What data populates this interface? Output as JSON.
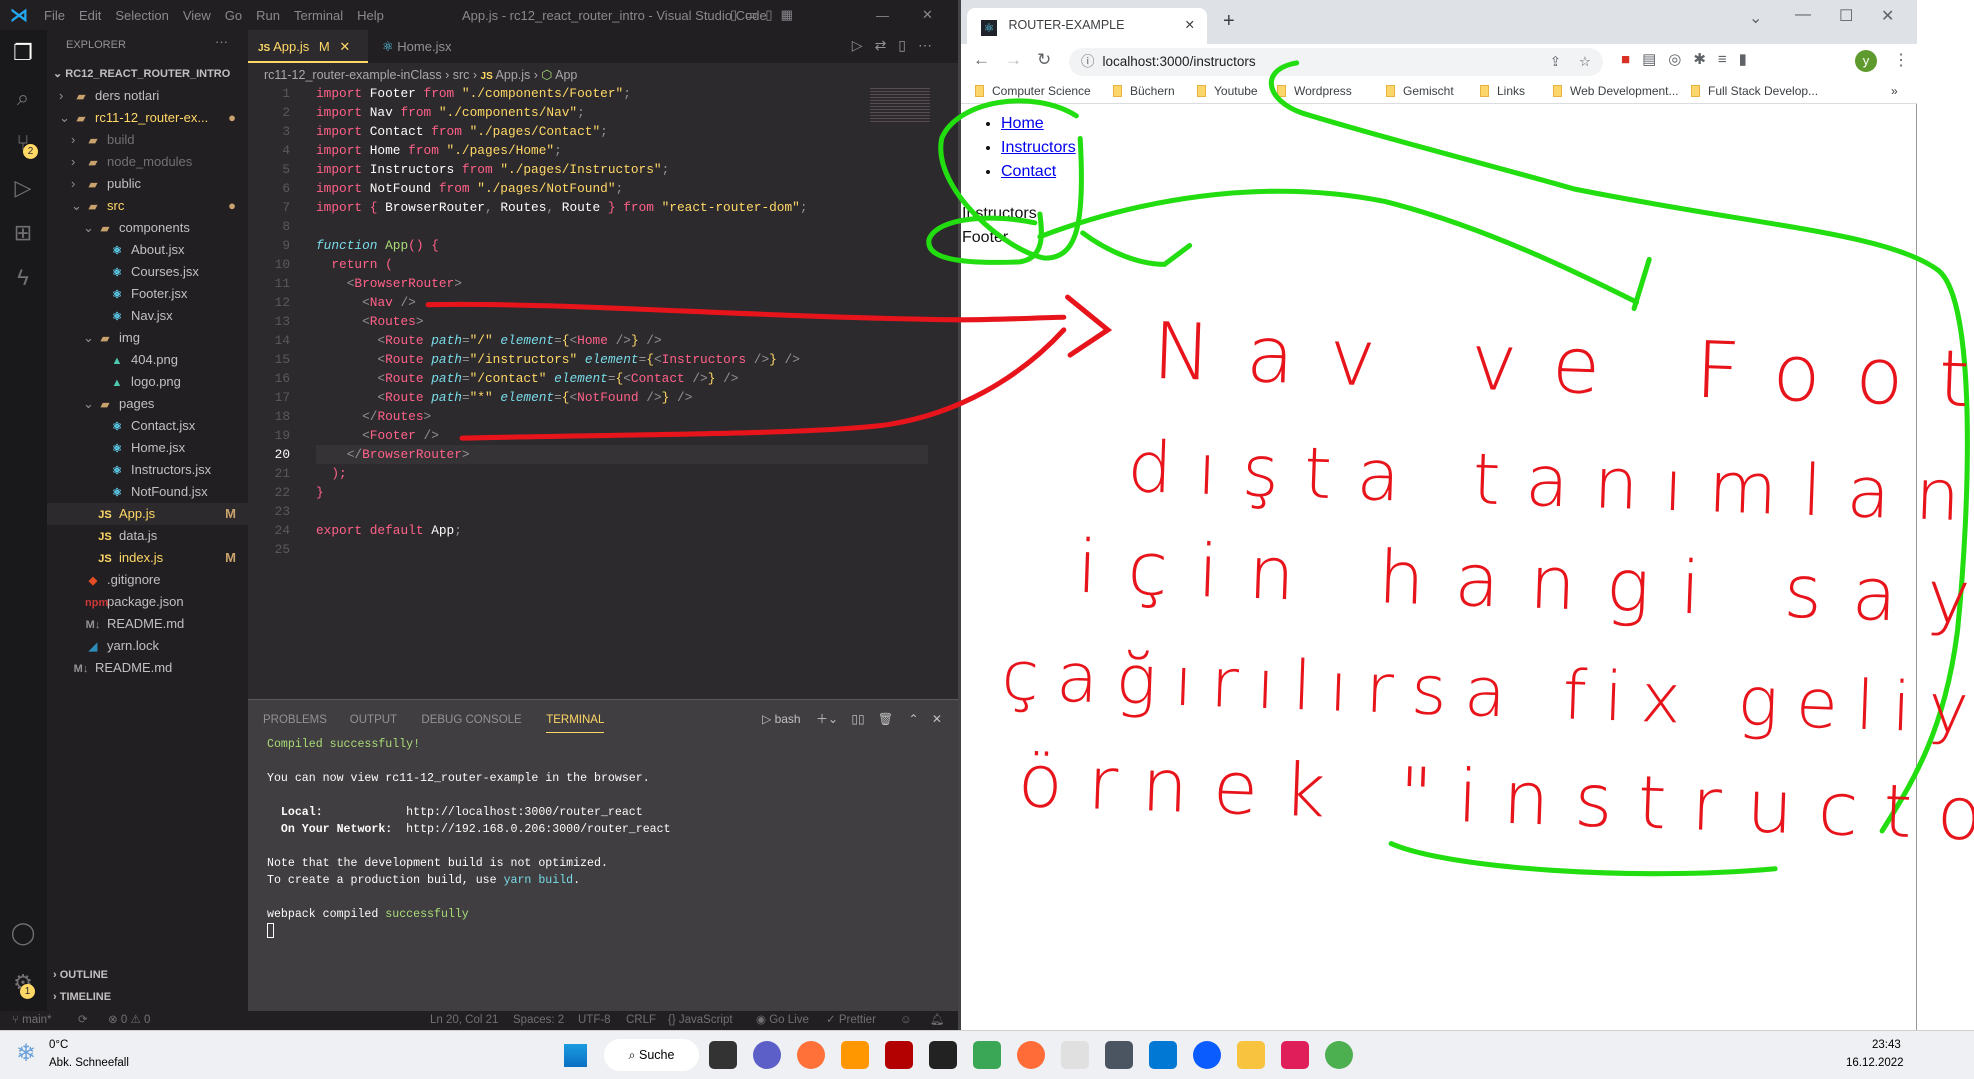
{
  "vscode": {
    "menu": [
      "File",
      "Edit",
      "Selection",
      "View",
      "Go",
      "Run",
      "Terminal",
      "Help"
    ],
    "window_title": "App.js - rc12_react_router_intro - Visual Studio Code",
    "activity_badges": {
      "scm": "2",
      "settings": "1"
    },
    "explorer": {
      "title": "EXPLORER",
      "root": "RC12_REACT_ROUTER_INTRO",
      "items": [
        {
          "label": "ders notlari",
          "depth": 1,
          "icon": "folder",
          "chev": "closed"
        },
        {
          "label": "rc11-12_router-ex...",
          "depth": 1,
          "icon": "folder-open",
          "chev": "open",
          "status": "●",
          "color": "#ffd866"
        },
        {
          "label": "build",
          "depth": 2,
          "icon": "folder",
          "chev": "closed",
          "color": "#727072"
        },
        {
          "label": "node_modules",
          "depth": 2,
          "icon": "folder",
          "chev": "closed",
          "color": "#727072"
        },
        {
          "label": "public",
          "depth": 2,
          "icon": "folder",
          "chev": "closed"
        },
        {
          "label": "src",
          "depth": 2,
          "icon": "folder-open",
          "chev": "open",
          "status": "●",
          "color": "#ffd866"
        },
        {
          "label": "components",
          "depth": 3,
          "icon": "folder-open",
          "chev": "open"
        },
        {
          "label": "About.jsx",
          "depth": 4,
          "icon": "react"
        },
        {
          "label": "Courses.jsx",
          "depth": 4,
          "icon": "react"
        },
        {
          "label": "Footer.jsx",
          "depth": 4,
          "icon": "react"
        },
        {
          "label": "Nav.jsx",
          "depth": 4,
          "icon": "react"
        },
        {
          "label": "img",
          "depth": 3,
          "icon": "folder-open",
          "chev": "open"
        },
        {
          "label": "404.png",
          "depth": 4,
          "icon": "image"
        },
        {
          "label": "logo.png",
          "depth": 4,
          "icon": "image"
        },
        {
          "label": "pages",
          "depth": 3,
          "icon": "folder-open",
          "chev": "open"
        },
        {
          "label": "Contact.jsx",
          "depth": 4,
          "icon": "react"
        },
        {
          "label": "Home.jsx",
          "depth": 4,
          "icon": "react"
        },
        {
          "label": "Instructors.jsx",
          "depth": 4,
          "icon": "react"
        },
        {
          "label": "NotFound.jsx",
          "depth": 4,
          "icon": "react"
        },
        {
          "label": "App.js",
          "depth": 3,
          "icon": "js",
          "status": "M",
          "color": "#ffd866",
          "active": true
        },
        {
          "label": "data.js",
          "depth": 3,
          "icon": "js"
        },
        {
          "label": "index.js",
          "depth": 3,
          "icon": "js",
          "status": "M",
          "color": "#ffd866"
        },
        {
          "label": ".gitignore",
          "depth": 2,
          "icon": "git"
        },
        {
          "label": "package.json",
          "depth": 2,
          "icon": "npm"
        },
        {
          "label": "README.md",
          "depth": 2,
          "icon": "md"
        },
        {
          "label": "yarn.lock",
          "depth": 2,
          "icon": "yarn"
        },
        {
          "label": "README.md",
          "depth": 1,
          "icon": "md"
        }
      ],
      "outline": "OUTLINE",
      "timeline": "TIMELINE"
    },
    "tabs": [
      {
        "label": "App.js",
        "icon": "JS",
        "modified": "M",
        "active": true
      },
      {
        "label": "Home.jsx",
        "icon": "react"
      }
    ],
    "breadcrumb": [
      "rc11-12_router-example-inClass",
      "src",
      "App.js",
      "App"
    ],
    "code": [
      [
        [
          "import",
          "k"
        ],
        [
          " Footer ",
          "t"
        ],
        [
          "from",
          "k"
        ],
        [
          " \"./components/Footer\"",
          "s"
        ],
        [
          ";",
          "p"
        ]
      ],
      [
        [
          "import",
          "k"
        ],
        [
          " Nav ",
          "t"
        ],
        [
          "from",
          "k"
        ],
        [
          " \"./components/Nav\"",
          "s"
        ],
        [
          ";",
          "p"
        ]
      ],
      [
        [
          "import",
          "k"
        ],
        [
          " Contact ",
          "t"
        ],
        [
          "from",
          "k"
        ],
        [
          " \"./pages/Contact\"",
          "s"
        ],
        [
          ";",
          "p"
        ]
      ],
      [
        [
          "import",
          "k"
        ],
        [
          " Home ",
          "t"
        ],
        [
          "from",
          "k"
        ],
        [
          " \"./pages/Home\"",
          "s"
        ],
        [
          ";",
          "p"
        ]
      ],
      [
        [
          "import",
          "k"
        ],
        [
          " Instructors ",
          "t"
        ],
        [
          "from",
          "k"
        ],
        [
          " \"./pages/Instructors\"",
          "s"
        ],
        [
          ";",
          "p"
        ]
      ],
      [
        [
          "import",
          "k"
        ],
        [
          " NotFound ",
          "t"
        ],
        [
          "from",
          "k"
        ],
        [
          " \"./pages/NotFound\"",
          "s"
        ],
        [
          ";",
          "p"
        ]
      ],
      [
        [
          "import",
          "k"
        ],
        [
          " { ",
          "k"
        ],
        [
          "BrowserRouter",
          "t"
        ],
        [
          ", ",
          "p"
        ],
        [
          "Routes",
          "t"
        ],
        [
          ", ",
          "p"
        ],
        [
          "Route",
          "t"
        ],
        [
          " } ",
          "k"
        ],
        [
          "from",
          "k"
        ],
        [
          " \"react-router-dom\"",
          "s"
        ],
        [
          ";",
          "p"
        ]
      ],
      [],
      [
        [
          "function",
          "c"
        ],
        [
          " App",
          "f"
        ],
        [
          "() {",
          "k"
        ]
      ],
      [
        [
          "  return",
          "k"
        ],
        [
          " (",
          "k"
        ]
      ],
      [
        [
          "    <",
          "p"
        ],
        [
          "BrowserRouter",
          "k"
        ],
        [
          ">",
          "p"
        ]
      ],
      [
        [
          "      <",
          "p"
        ],
        [
          "Nav",
          "k"
        ],
        [
          " />",
          "p"
        ]
      ],
      [
        [
          "      <",
          "p"
        ],
        [
          "Routes",
          "k"
        ],
        [
          ">",
          "p"
        ]
      ],
      [
        [
          "        <",
          "p"
        ],
        [
          "Route",
          "k"
        ],
        [
          " path",
          "c"
        ],
        [
          "=",
          "p"
        ],
        [
          "\"/\"",
          "s"
        ],
        [
          " element",
          "c"
        ],
        [
          "=",
          "p"
        ],
        [
          "{",
          "b"
        ],
        [
          "<",
          "p"
        ],
        [
          "Home",
          "k"
        ],
        [
          " />",
          "p"
        ],
        [
          "}",
          "b"
        ],
        [
          " />",
          "p"
        ]
      ],
      [
        [
          "        <",
          "p"
        ],
        [
          "Route",
          "k"
        ],
        [
          " path",
          "c"
        ],
        [
          "=",
          "p"
        ],
        [
          "\"/instructors\"",
          "s"
        ],
        [
          " element",
          "c"
        ],
        [
          "=",
          "p"
        ],
        [
          "{",
          "b"
        ],
        [
          "<",
          "p"
        ],
        [
          "Instructors",
          "k"
        ],
        [
          " />",
          "p"
        ],
        [
          "}",
          "b"
        ],
        [
          " />",
          "p"
        ]
      ],
      [
        [
          "        <",
          "p"
        ],
        [
          "Route",
          "k"
        ],
        [
          " path",
          "c"
        ],
        [
          "=",
          "p"
        ],
        [
          "\"/contact\"",
          "s"
        ],
        [
          " element",
          "c"
        ],
        [
          "=",
          "p"
        ],
        [
          "{",
          "b"
        ],
        [
          "<",
          "p"
        ],
        [
          "Contact",
          "k"
        ],
        [
          " />",
          "p"
        ],
        [
          "}",
          "b"
        ],
        [
          " />",
          "p"
        ]
      ],
      [
        [
          "        <",
          "p"
        ],
        [
          "Route",
          "k"
        ],
        [
          " path",
          "c"
        ],
        [
          "=",
          "p"
        ],
        [
          "\"*\"",
          "s"
        ],
        [
          " element",
          "c"
        ],
        [
          "=",
          "p"
        ],
        [
          "{",
          "b"
        ],
        [
          "<",
          "p"
        ],
        [
          "NotFound",
          "k"
        ],
        [
          " />",
          "p"
        ],
        [
          "}",
          "b"
        ],
        [
          " />",
          "p"
        ]
      ],
      [
        [
          "      </",
          "p"
        ],
        [
          "Routes",
          "k"
        ],
        [
          ">",
          "p"
        ]
      ],
      [
        [
          "      <",
          "p"
        ],
        [
          "Footer",
          "k"
        ],
        [
          " />",
          "p"
        ]
      ],
      [
        [
          "    </",
          "p"
        ],
        [
          "BrowserRouter",
          "k"
        ],
        [
          ">",
          "p"
        ]
      ],
      [
        [
          "  );",
          "k"
        ]
      ],
      [
        [
          "}",
          "k"
        ]
      ],
      [],
      [
        [
          "export default",
          "k"
        ],
        [
          " App",
          "t"
        ],
        [
          ";",
          "p"
        ]
      ],
      []
    ],
    "current_line": 20,
    "panel": {
      "tabs": [
        "PROBLEMS",
        "OUTPUT",
        "DEBUG CONSOLE",
        "TERMINAL"
      ],
      "active_tab": "TERMINAL",
      "shell": "bash",
      "terminal": {
        "compiled": "Compiled successfully!",
        "view_line": "You can now view rc11-12_router-example in the browser.",
        "local_label": "  Local:            ",
        "local_url": "http://localhost:3000/router_react",
        "network_label": "  On Your Network:  ",
        "network_url": "http://192.168.0.206:3000/router_react",
        "note1": "Note that the development build is not optimized.",
        "note2_pre": "To create a production build, use ",
        "note2_cmd": "yarn build",
        "note2_post": ".",
        "webpack_pre": "webpack compiled ",
        "webpack_ok": "successfully"
      }
    },
    "status": {
      "branch": "main*",
      "errors": "0",
      "warnings": "0",
      "position": "Ln 20, Col 21",
      "spaces": "Spaces: 2",
      "encoding": "UTF-8",
      "eol": "CRLF",
      "language": "JavaScript",
      "golive": "Go Live",
      "prettier": "Prettier"
    }
  },
  "browser": {
    "tab_title": "ROUTER-EXAMPLE",
    "url": "localhost:3000/instructors",
    "profile": "y",
    "bookmarks": [
      "Computer Science",
      "Büchern",
      "Youtube",
      "Wordpress",
      "Gemischt",
      "Links",
      "Web Development...",
      "Full Stack Develop..."
    ],
    "page": {
      "nav": [
        "Home",
        "Instructors",
        "Contact"
      ],
      "content": "Instructors",
      "footer": "Footer"
    }
  },
  "annotation": {
    "color_red": "#e8141b",
    "color_green": "#22dd0f",
    "lines": [
      "Nav ve Footer",
      "dışta tanımlandığı",
      "için hangi sayfa",
      "çağırılırsa fix geliyorlar",
      "örnek \"instructors\""
    ]
  },
  "taskbar": {
    "weather_temp": "0°C",
    "weather_desc": "Abk. Schneefall",
    "search": "Suche",
    "time": "23:43",
    "date": "16.12.2022",
    "apps": [
      {
        "name": "task-view",
        "color": "#333"
      },
      {
        "name": "teams",
        "color": "#5b5fc7"
      },
      {
        "name": "firefox",
        "color": "#ff7139"
      },
      {
        "name": "sublime",
        "color": "#ff9800"
      },
      {
        "name": "filezilla",
        "color": "#b30000"
      },
      {
        "name": "sticky",
        "color": "#222"
      },
      {
        "name": "gitkraken",
        "color": "#3aa757"
      },
      {
        "name": "postman",
        "color": "#ff6c37"
      },
      {
        "name": "snipping-tool",
        "color": "#e0e0e0"
      },
      {
        "name": "calculator",
        "color": "#4a5561"
      },
      {
        "name": "vscode",
        "color": "#0078d4"
      },
      {
        "name": "zoom",
        "color": "#0b5cff"
      },
      {
        "name": "file-explorer",
        "color": "#f8c33f"
      },
      {
        "name": "slack",
        "color": "#e01e5a"
      },
      {
        "name": "chrome",
        "color": "#4caf50"
      }
    ]
  }
}
